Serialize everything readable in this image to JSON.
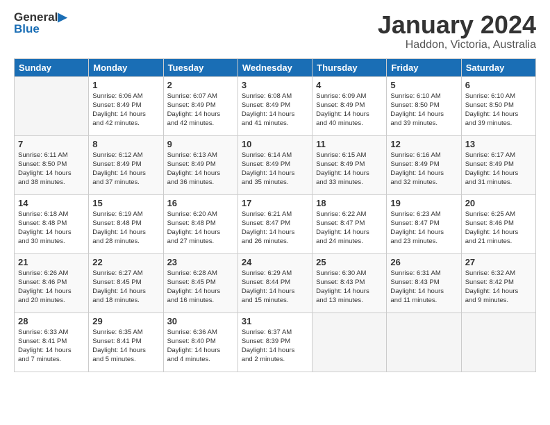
{
  "header": {
    "logo_line1": "General",
    "logo_line2": "Blue",
    "title": "January 2024",
    "subtitle": "Haddon, Victoria, Australia"
  },
  "days_of_week": [
    "Sunday",
    "Monday",
    "Tuesday",
    "Wednesday",
    "Thursday",
    "Friday",
    "Saturday"
  ],
  "weeks": [
    [
      {
        "day": "",
        "info": ""
      },
      {
        "day": "1",
        "info": "Sunrise: 6:06 AM\nSunset: 8:49 PM\nDaylight: 14 hours\nand 42 minutes."
      },
      {
        "day": "2",
        "info": "Sunrise: 6:07 AM\nSunset: 8:49 PM\nDaylight: 14 hours\nand 42 minutes."
      },
      {
        "day": "3",
        "info": "Sunrise: 6:08 AM\nSunset: 8:49 PM\nDaylight: 14 hours\nand 41 minutes."
      },
      {
        "day": "4",
        "info": "Sunrise: 6:09 AM\nSunset: 8:49 PM\nDaylight: 14 hours\nand 40 minutes."
      },
      {
        "day": "5",
        "info": "Sunrise: 6:10 AM\nSunset: 8:50 PM\nDaylight: 14 hours\nand 39 minutes."
      },
      {
        "day": "6",
        "info": "Sunrise: 6:10 AM\nSunset: 8:50 PM\nDaylight: 14 hours\nand 39 minutes."
      }
    ],
    [
      {
        "day": "7",
        "info": "Sunrise: 6:11 AM\nSunset: 8:50 PM\nDaylight: 14 hours\nand 38 minutes."
      },
      {
        "day": "8",
        "info": "Sunrise: 6:12 AM\nSunset: 8:49 PM\nDaylight: 14 hours\nand 37 minutes."
      },
      {
        "day": "9",
        "info": "Sunrise: 6:13 AM\nSunset: 8:49 PM\nDaylight: 14 hours\nand 36 minutes."
      },
      {
        "day": "10",
        "info": "Sunrise: 6:14 AM\nSunset: 8:49 PM\nDaylight: 14 hours\nand 35 minutes."
      },
      {
        "day": "11",
        "info": "Sunrise: 6:15 AM\nSunset: 8:49 PM\nDaylight: 14 hours\nand 33 minutes."
      },
      {
        "day": "12",
        "info": "Sunrise: 6:16 AM\nSunset: 8:49 PM\nDaylight: 14 hours\nand 32 minutes."
      },
      {
        "day": "13",
        "info": "Sunrise: 6:17 AM\nSunset: 8:49 PM\nDaylight: 14 hours\nand 31 minutes."
      }
    ],
    [
      {
        "day": "14",
        "info": "Sunrise: 6:18 AM\nSunset: 8:48 PM\nDaylight: 14 hours\nand 30 minutes."
      },
      {
        "day": "15",
        "info": "Sunrise: 6:19 AM\nSunset: 8:48 PM\nDaylight: 14 hours\nand 28 minutes."
      },
      {
        "day": "16",
        "info": "Sunrise: 6:20 AM\nSunset: 8:48 PM\nDaylight: 14 hours\nand 27 minutes."
      },
      {
        "day": "17",
        "info": "Sunrise: 6:21 AM\nSunset: 8:47 PM\nDaylight: 14 hours\nand 26 minutes."
      },
      {
        "day": "18",
        "info": "Sunrise: 6:22 AM\nSunset: 8:47 PM\nDaylight: 14 hours\nand 24 minutes."
      },
      {
        "day": "19",
        "info": "Sunrise: 6:23 AM\nSunset: 8:47 PM\nDaylight: 14 hours\nand 23 minutes."
      },
      {
        "day": "20",
        "info": "Sunrise: 6:25 AM\nSunset: 8:46 PM\nDaylight: 14 hours\nand 21 minutes."
      }
    ],
    [
      {
        "day": "21",
        "info": "Sunrise: 6:26 AM\nSunset: 8:46 PM\nDaylight: 14 hours\nand 20 minutes."
      },
      {
        "day": "22",
        "info": "Sunrise: 6:27 AM\nSunset: 8:45 PM\nDaylight: 14 hours\nand 18 minutes."
      },
      {
        "day": "23",
        "info": "Sunrise: 6:28 AM\nSunset: 8:45 PM\nDaylight: 14 hours\nand 16 minutes."
      },
      {
        "day": "24",
        "info": "Sunrise: 6:29 AM\nSunset: 8:44 PM\nDaylight: 14 hours\nand 15 minutes."
      },
      {
        "day": "25",
        "info": "Sunrise: 6:30 AM\nSunset: 8:43 PM\nDaylight: 14 hours\nand 13 minutes."
      },
      {
        "day": "26",
        "info": "Sunrise: 6:31 AM\nSunset: 8:43 PM\nDaylight: 14 hours\nand 11 minutes."
      },
      {
        "day": "27",
        "info": "Sunrise: 6:32 AM\nSunset: 8:42 PM\nDaylight: 14 hours\nand 9 minutes."
      }
    ],
    [
      {
        "day": "28",
        "info": "Sunrise: 6:33 AM\nSunset: 8:41 PM\nDaylight: 14 hours\nand 7 minutes."
      },
      {
        "day": "29",
        "info": "Sunrise: 6:35 AM\nSunset: 8:41 PM\nDaylight: 14 hours\nand 5 minutes."
      },
      {
        "day": "30",
        "info": "Sunrise: 6:36 AM\nSunset: 8:40 PM\nDaylight: 14 hours\nand 4 minutes."
      },
      {
        "day": "31",
        "info": "Sunrise: 6:37 AM\nSunset: 8:39 PM\nDaylight: 14 hours\nand 2 minutes."
      },
      {
        "day": "",
        "info": ""
      },
      {
        "day": "",
        "info": ""
      },
      {
        "day": "",
        "info": ""
      }
    ]
  ]
}
